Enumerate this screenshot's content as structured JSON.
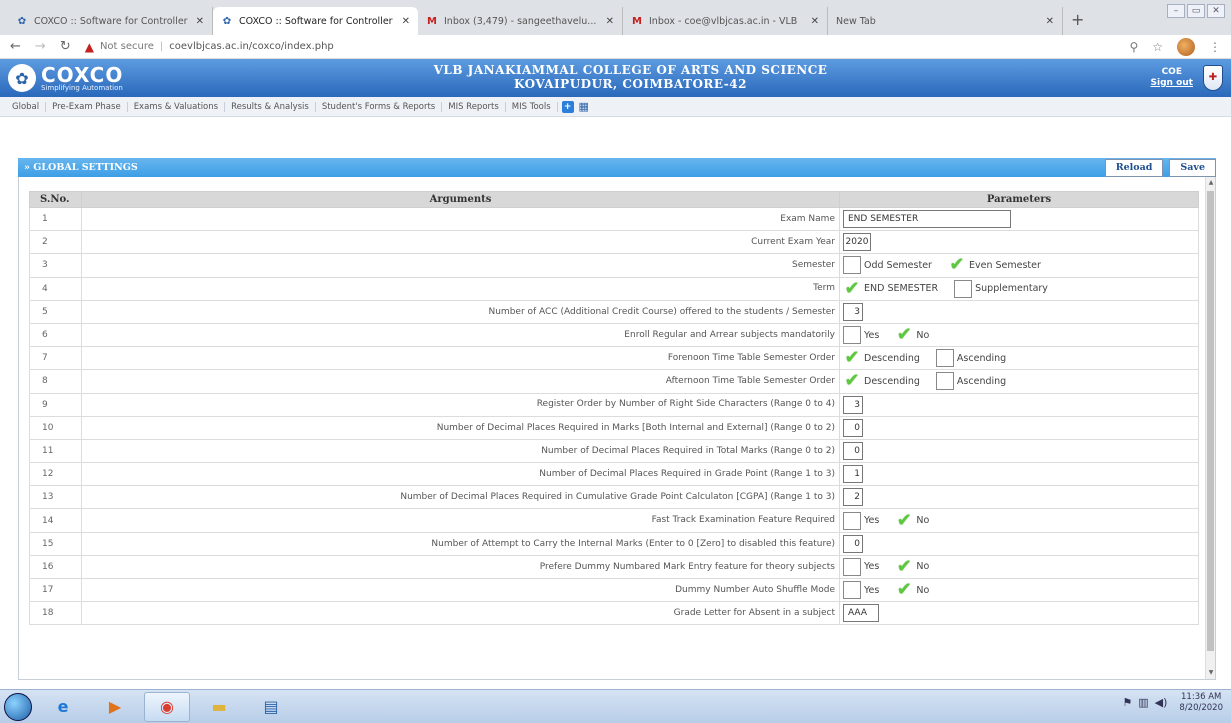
{
  "browser": {
    "tabs": [
      {
        "title": "COXCO :: Software for Controller",
        "active": false,
        "icon": "coxco-logo-icon"
      },
      {
        "title": "COXCO :: Software for Controller",
        "active": true,
        "icon": "coxco-logo-icon"
      },
      {
        "title": "Inbox (3,479) - sangeethavelu...",
        "active": false,
        "icon": "gmail-icon"
      },
      {
        "title": "Inbox - coe@vlbjcas.ac.in - VLB",
        "active": false,
        "icon": "gmail-icon"
      },
      {
        "title": "New Tab",
        "active": false,
        "icon": ""
      }
    ],
    "address": {
      "security_label": "Not secure",
      "url": "coevlbjcas.ac.in/coxco/index.php"
    }
  },
  "header": {
    "logo_name": "COXCO",
    "logo_tagline": "Simplifying Automation",
    "college_line1": "VLB JANAKIAMMAL COLLEGE OF ARTS AND SCIENCE",
    "college_line2": "KOVAIPUDUR, COIMBATORE-42",
    "role": "COE",
    "signout": "Sign out"
  },
  "menu": [
    "Global",
    "Pre-Exam Phase",
    "Exams & Valuations",
    "Results & Analysis",
    "Student's Forms & Reports",
    "MIS Reports",
    "MIS Tools"
  ],
  "panel": {
    "title": "» GLOBAL SETTINGS",
    "reload_label": "Reload",
    "save_label": "Save",
    "col_sno": "S.No.",
    "col_args": "Arguments",
    "col_params": "Parameters"
  },
  "rows": [
    {
      "sno": "1",
      "arg": "Exam Name",
      "type": "text",
      "value": "END SEMESTER"
    },
    {
      "sno": "2",
      "arg": "Current Exam Year",
      "type": "year",
      "value": "2020"
    },
    {
      "sno": "3",
      "arg": "Semester",
      "type": "choice",
      "options": [
        {
          "label": "Odd Semester",
          "checked": false
        },
        {
          "label": "Even Semester",
          "checked": true
        }
      ]
    },
    {
      "sno": "4",
      "arg": "Term",
      "type": "choice",
      "options": [
        {
          "label": "END SEMESTER",
          "checked": true
        },
        {
          "label": "Supplementary",
          "checked": false
        }
      ]
    },
    {
      "sno": "5",
      "arg": "Number of ACC (Additional Credit Course) offered to the students / Semester",
      "type": "num",
      "value": "3"
    },
    {
      "sno": "6",
      "arg": "Enroll Regular and Arrear subjects mandatorily",
      "type": "choice",
      "options": [
        {
          "label": "Yes",
          "checked": false
        },
        {
          "label": "No",
          "checked": true
        }
      ]
    },
    {
      "sno": "7",
      "arg": "Forenoon Time Table Semester Order",
      "type": "choice",
      "options": [
        {
          "label": "Descending",
          "checked": true
        },
        {
          "label": "Ascending",
          "checked": false
        }
      ]
    },
    {
      "sno": "8",
      "arg": "Afternoon Time Table Semester Order",
      "type": "choice",
      "options": [
        {
          "label": "Descending",
          "checked": true
        },
        {
          "label": "Ascending",
          "checked": false
        }
      ]
    },
    {
      "sno": "9",
      "arg": "Register Order by Number of Right Side Characters (Range 0 to 4)",
      "type": "num",
      "value": "3"
    },
    {
      "sno": "10",
      "arg": "Number of Decimal Places Required in Marks [Both Internal and External] (Range 0 to 2)",
      "type": "num",
      "value": "0"
    },
    {
      "sno": "11",
      "arg": "Number of Decimal Places Required in Total Marks (Range 0 to 2)",
      "type": "num",
      "value": "0"
    },
    {
      "sno": "12",
      "arg": "Number of Decimal Places Required in Grade Point (Range 1 to 3)",
      "type": "num",
      "value": "1"
    },
    {
      "sno": "13",
      "arg": "Number of Decimal Places Required in Cumulative Grade Point Calculaton [CGPA] (Range 1 to 3)",
      "type": "num",
      "value": "2"
    },
    {
      "sno": "14",
      "arg": "Fast Track Examination Feature Required",
      "type": "choice",
      "options": [
        {
          "label": "Yes",
          "checked": false
        },
        {
          "label": "No",
          "checked": true
        }
      ]
    },
    {
      "sno": "15",
      "arg": "Number of Attempt to Carry the Internal Marks (Enter to 0 [Zero] to disabled this feature)",
      "type": "num",
      "value": "0"
    },
    {
      "sno": "16",
      "arg": "Prefere Dummy Numbared Mark Entry feature for theory subjects",
      "type": "choice",
      "options": [
        {
          "label": "Yes",
          "checked": false
        },
        {
          "label": "No",
          "checked": true
        }
      ]
    },
    {
      "sno": "17",
      "arg": "Dummy Number Auto Shuffle Mode",
      "type": "choice",
      "options": [
        {
          "label": "Yes",
          "checked": false
        },
        {
          "label": "No",
          "checked": true
        }
      ]
    },
    {
      "sno": "18",
      "arg": "Grade Letter for Absent in a subject",
      "type": "grade",
      "value": "AAA"
    }
  ],
  "taskbar": {
    "clock_time": "11:36 AM",
    "clock_date": "8/20/2020"
  }
}
